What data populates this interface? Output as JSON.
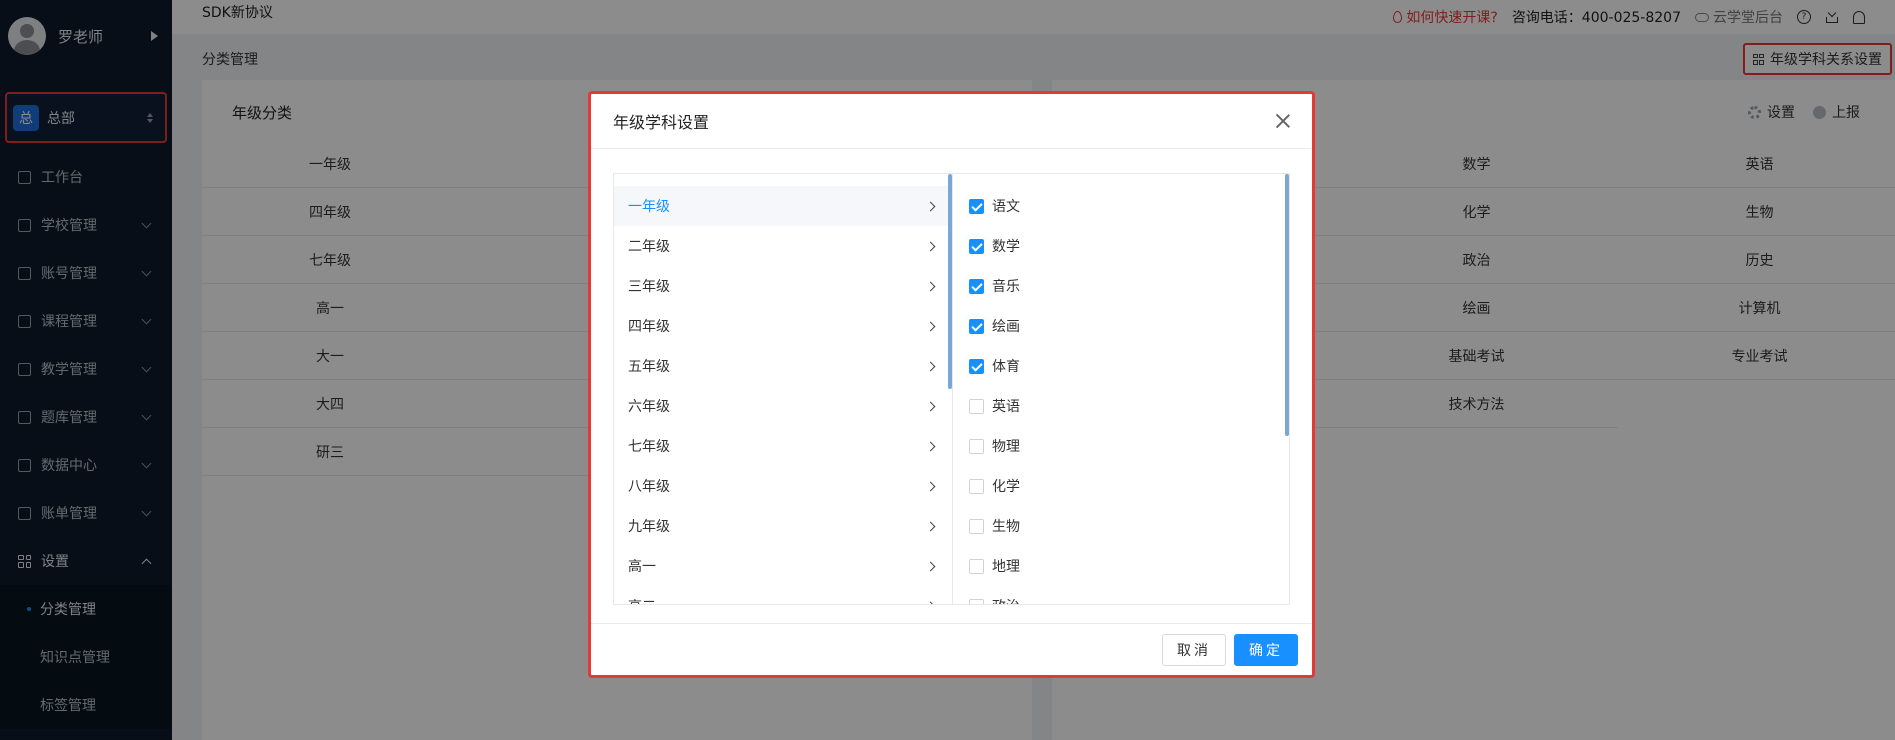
{
  "sidebar": {
    "user_name": "罗老师",
    "org_badge": "总",
    "org_name": "总部",
    "menu": [
      {
        "label": "工作台",
        "icon": "monitor-icon"
      },
      {
        "label": "学校管理",
        "icon": "school-icon"
      },
      {
        "label": "账号管理",
        "icon": "users-icon"
      },
      {
        "label": "课程管理",
        "icon": "course-icon"
      },
      {
        "label": "教学管理",
        "icon": "teaching-icon"
      },
      {
        "label": "题库管理",
        "icon": "question-bank-icon"
      },
      {
        "label": "数据中心",
        "icon": "chart-icon"
      },
      {
        "label": "账单管理",
        "icon": "bill-icon"
      },
      {
        "label": "设置",
        "icon": "grid-icon"
      }
    ],
    "sub_menu": [
      "分类管理",
      "知识点管理",
      "标签管理"
    ]
  },
  "topbar": {
    "project": "SDK新协议",
    "hint": "如何快速开课?",
    "phone": "咨询电话：400-025-8207",
    "backend": "云学堂后台",
    "help_symbol": "?"
  },
  "page": {
    "breadcrumb": "分类管理",
    "relation_button": "年级学科关系设置",
    "grade_panel_title": "年级分类",
    "grade_cells": [
      "一年级",
      "四年级",
      "七年级",
      "高一",
      "大一",
      "大四",
      "研三"
    ],
    "tools": {
      "settings": "设置",
      "report": "上报"
    },
    "subject_cells": [
      "数学",
      "英语",
      "化学",
      "生物",
      "政治",
      "历史",
      "绘画",
      "计算机",
      "基础考试",
      "专业考试",
      "技术方法"
    ]
  },
  "modal": {
    "title": "年级学科设置",
    "grades": [
      "一年级",
      "二年级",
      "三年级",
      "四年级",
      "五年级",
      "六年级",
      "七年级",
      "八年级",
      "九年级",
      "高一",
      "高二"
    ],
    "subjects": [
      {
        "label": "语文",
        "checked": true
      },
      {
        "label": "数学",
        "checked": true
      },
      {
        "label": "音乐",
        "checked": true
      },
      {
        "label": "绘画",
        "checked": true
      },
      {
        "label": "体育",
        "checked": true
      },
      {
        "label": "英语",
        "checked": false
      },
      {
        "label": "物理",
        "checked": false
      },
      {
        "label": "化学",
        "checked": false
      },
      {
        "label": "生物",
        "checked": false
      },
      {
        "label": "地理",
        "checked": false
      },
      {
        "label": "政治",
        "checked": false
      }
    ],
    "cancel": "取消",
    "ok": "确定"
  },
  "colors": {
    "accent": "#1890ff",
    "highlight": "#e53935",
    "sidebar": "#0d1b2a"
  }
}
